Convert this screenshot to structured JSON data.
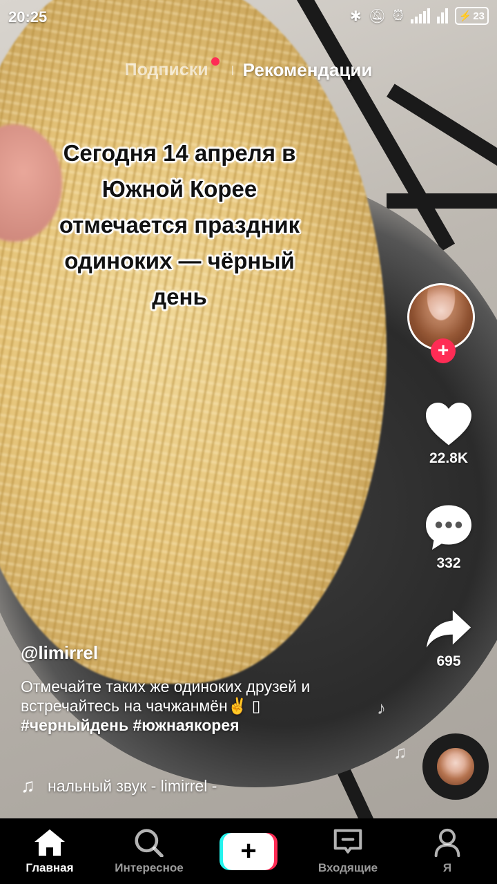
{
  "status_bar": {
    "time": "20:25",
    "battery": "23",
    "icons": [
      "bluetooth-icon",
      "mute-icon",
      "alarm-icon",
      "signal-icon",
      "signal-icon-2",
      "battery-icon"
    ]
  },
  "top_tabs": {
    "following": "Подписки",
    "recommended": "Рекомендации",
    "active": "recommended"
  },
  "video": {
    "overlay_caption": "Сегодня 14 апреля в\nЮжной Корее\nотмечается праздник\nодиноких — чёрный\nдень"
  },
  "post": {
    "username": "@limirrel",
    "description": "Отмечайте таких же одиноких друзей и встречайтесь на чачжанмён✌️",
    "hashtags": [
      "#черныйдень",
      "#южнаякорея"
    ],
    "sound": "нальный звук - limirrel -"
  },
  "actions": {
    "likes": "22.8K",
    "comments": "332",
    "shares": "695"
  },
  "bottom_nav": {
    "items": [
      {
        "label": "Главная",
        "icon": "home-icon",
        "active": true
      },
      {
        "label": "Интересное",
        "icon": "search-icon",
        "active": false
      },
      {
        "label": "",
        "icon": "plus-icon",
        "active": false
      },
      {
        "label": "Входящие",
        "icon": "inbox-icon",
        "active": false
      },
      {
        "label": "Я",
        "icon": "profile-icon",
        "active": false
      }
    ]
  },
  "colors": {
    "accent": "#fe2c55",
    "cyan": "#25f4ee"
  }
}
